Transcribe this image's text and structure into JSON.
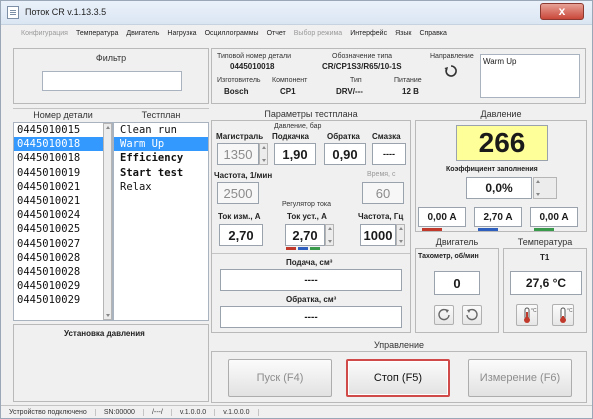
{
  "window": {
    "title": "Поток CR v.1.13.3.5",
    "close_glyph": "x"
  },
  "menu": [
    {
      "label": "Конфигурация",
      "enabled": false
    },
    {
      "label": "Температура",
      "enabled": true
    },
    {
      "label": "Двигатель",
      "enabled": true
    },
    {
      "label": "Нагрузка",
      "enabled": true
    },
    {
      "label": "Осциллограммы",
      "enabled": true
    },
    {
      "label": "Отчет",
      "enabled": true
    },
    {
      "label": "Выбор режима",
      "enabled": false
    },
    {
      "label": "Интерфейс",
      "enabled": true
    },
    {
      "label": "Язык",
      "enabled": true
    },
    {
      "label": "Справка",
      "enabled": true
    }
  ],
  "filter": {
    "title": "Фильтр",
    "value": ""
  },
  "part_info": {
    "part_number_label": "Типовой номер детали",
    "part_number_value": "0445010018",
    "type_label": "Обозначение типа",
    "type_value": "CR/CP1S3/R65/10-1S",
    "direction_label": "Направление",
    "manufacturer_label": "Изготовитель",
    "manufacturer_value": "Bosch",
    "component_label": "Компонент",
    "component_value": "CP1",
    "kind_label": "Тип",
    "kind_value": "DRV/---",
    "supply_label": "Питание",
    "supply_value": "12 В",
    "note_value": "Warm Up"
  },
  "parts_list": {
    "header": "Номер детали",
    "items": [
      "0445010015",
      "0445010018",
      "0445010018",
      "0445010019",
      "0445010021",
      "0445010021",
      "0445010024",
      "0445010025",
      "0445010027",
      "0445010028",
      "0445010028",
      "0445010029",
      "0445010029"
    ],
    "selected_index": 1
  },
  "testplan": {
    "header": "Тестплан",
    "items": [
      {
        "label": "Clean run",
        "bold": false
      },
      {
        "label": "Warm Up",
        "bold": false
      },
      {
        "label": "Efficiency",
        "bold": true
      },
      {
        "label": "Start test",
        "bold": true
      },
      {
        "label": "Relax",
        "bold": false
      }
    ],
    "selected_index": 1
  },
  "status_left": "Установка давления",
  "params": {
    "title": "Параметры тестплана",
    "pressure_group": "Давление, бар",
    "magistral_label": "Магистраль",
    "magistral_value": "1350",
    "podkachka_label": "Подкачка",
    "podkachka_value": "1,90",
    "obratka_label": "Обратка",
    "obratka_value": "0,90",
    "smazka_label": "Смазка",
    "smazka_value": "----",
    "freq_label": "Частота, 1/мин",
    "freq_value": "2500",
    "time_label": "Время, с",
    "time_value": "60",
    "regulator_group": "Регулятор тока",
    "tok_izm_label": "Ток изм., А",
    "tok_izm_value": "2,70",
    "tok_ust_label": "Ток уст., А",
    "tok_ust_value": "2,70",
    "freq_hz_label": "Частота, Гц",
    "freq_hz_value": "1000",
    "podacha_label": "Подача, см³",
    "podacha_value": "----",
    "obratka_cm_label": "Обратка, см³",
    "obratka_cm_value": "----"
  },
  "pressure": {
    "title": "Давление",
    "value": "266",
    "fill_label": "Коэффициент заполнения",
    "fill_value": "0,0%",
    "currents": [
      {
        "value": "0,00 A",
        "color": "#c0392b"
      },
      {
        "value": "2,70 A",
        "color": "#2e5fbf"
      },
      {
        "value": "0,00 A",
        "color": "#3a9a4c"
      }
    ]
  },
  "engine": {
    "title": "Двигатель",
    "tacho_label": "Тахометр, об/мин",
    "tacho_value": "0"
  },
  "temperature": {
    "title": "Температура",
    "t1_label": "T1",
    "t1_value": "27,6 °C"
  },
  "control": {
    "title": "Управление",
    "start_label": "Пуск (F4)",
    "stop_label": "Стоп (F5)",
    "measure_label": "Измерение (F6)"
  },
  "statusbar": [
    "Устройство подключено",
    "SN:00000",
    "/---/",
    "v.1.0.0.0",
    "v.1.0.0.0"
  ],
  "colors": {
    "highlight": "#ffff99",
    "selection": "#3399ff",
    "stop_border": "#d04a4a"
  }
}
